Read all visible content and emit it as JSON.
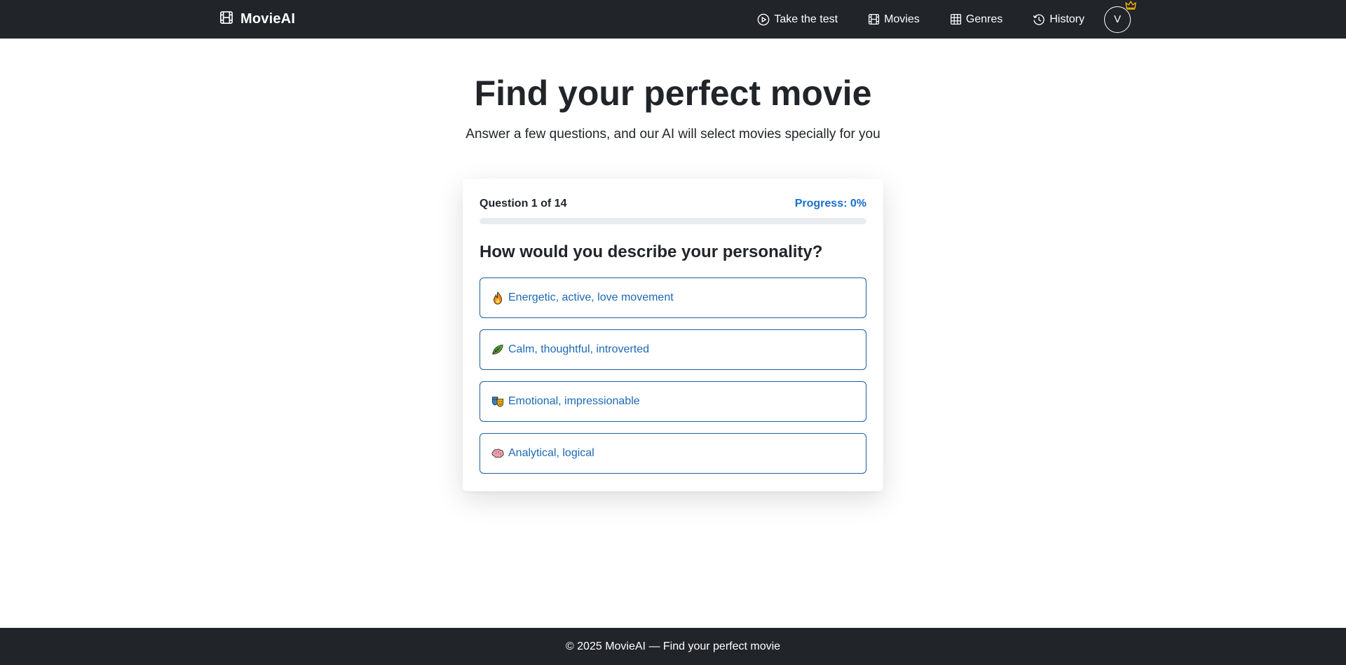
{
  "navbar": {
    "brand": {
      "label": "MovieAI",
      "icon": "film-icon"
    },
    "links": [
      {
        "label": "Take the test",
        "icon": "play-circle-icon"
      },
      {
        "label": "Movies",
        "icon": "film-icon"
      },
      {
        "label": "Genres",
        "icon": "grid-icon"
      },
      {
        "label": "History",
        "icon": "history-icon"
      }
    ],
    "avatar": {
      "initial": "V",
      "badge_icon": "crown-icon",
      "badge_color": "#f5b400"
    }
  },
  "hero": {
    "title": "Find your perfect movie",
    "subtitle": "Answer a few questions, and our AI will select movies specially for you"
  },
  "quiz": {
    "counter": "Question 1 of 14",
    "progress_label": "Progress: 0%",
    "progress_value": 0,
    "question": "How would you describe your personality?",
    "options": [
      {
        "icon": "fire-icon",
        "label": "Energetic, active, love movement"
      },
      {
        "icon": "leaf-icon",
        "label": "Calm, thoughtful, introverted"
      },
      {
        "icon": "theater-masks-icon",
        "label": "Emotional, impressionable"
      },
      {
        "icon": "brain-icon",
        "label": "Analytical, logical"
      }
    ]
  },
  "footer": {
    "text": "© 2025 MovieAI — Find your perfect movie"
  },
  "colors": {
    "nav_bg": "#212529",
    "accent": "#1a6fc9",
    "option_border": "#1d5f9e"
  }
}
